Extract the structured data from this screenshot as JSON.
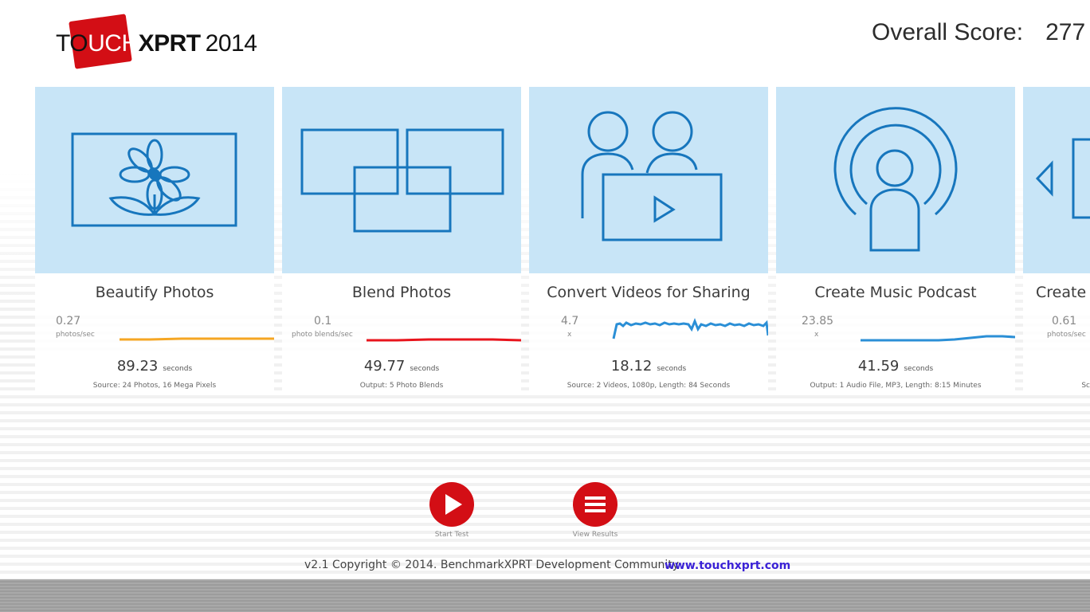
{
  "header": {
    "logo_touch_a": "TO",
    "logo_touch_b": "UCH",
    "logo_xprt": "XPRT",
    "logo_year": "2014",
    "overall_label": "Overall Score:",
    "overall_value": "277"
  },
  "colors": {
    "brand_red": "#d30e15",
    "tile_blue": "#c8e5f7",
    "icon_blue": "#1776bd",
    "graph_orange": "#f5a623",
    "graph_red": "#e8141c",
    "graph_blue": "#2b8fd6",
    "link_purple": "#3b22d6"
  },
  "tiles": [
    {
      "icon": "flower-photo-icon",
      "title": "Beautify Photos",
      "rate_value": "0.27",
      "rate_unit": "photos/sec",
      "time_value": "89.23",
      "time_unit": "seconds",
      "source": "Source: 24 Photos, 16 Mega Pixels"
    },
    {
      "icon": "blend-photos-icon",
      "title": "Blend Photos",
      "rate_value": "0.1",
      "rate_unit": "photo blends/sec",
      "time_value": "49.77",
      "time_unit": "seconds",
      "source": "Output: 5 Photo Blends"
    },
    {
      "icon": "users-video-icon",
      "title": "Convert Videos for Sharing",
      "rate_value": "4.7",
      "rate_unit": "x",
      "time_value": "18.12",
      "time_unit": "seconds",
      "source": "Source: 2 Videos, 1080p, Length: 84 Seconds"
    },
    {
      "icon": "podcast-icon",
      "title": "Create Music Podcast",
      "rate_value": "23.85",
      "rate_unit": "x",
      "time_value": "41.59",
      "time_unit": "seconds",
      "source": "Output: 1 Audio File, MP3, Length: 8:15 Minutes"
    },
    {
      "icon": "slideshow-icon",
      "title": "Create S",
      "rate_value": "0.61",
      "rate_unit": "photos/sec",
      "time_value": "",
      "time_unit": "",
      "source": "Sc"
    }
  ],
  "actions": {
    "start_label": "Start Test",
    "results_label": "View Results"
  },
  "footer": {
    "copyright": "v2.1 Copyright © 2014. BenchmarkXPRT Development Community",
    "link": "www.touchxprt.com"
  }
}
